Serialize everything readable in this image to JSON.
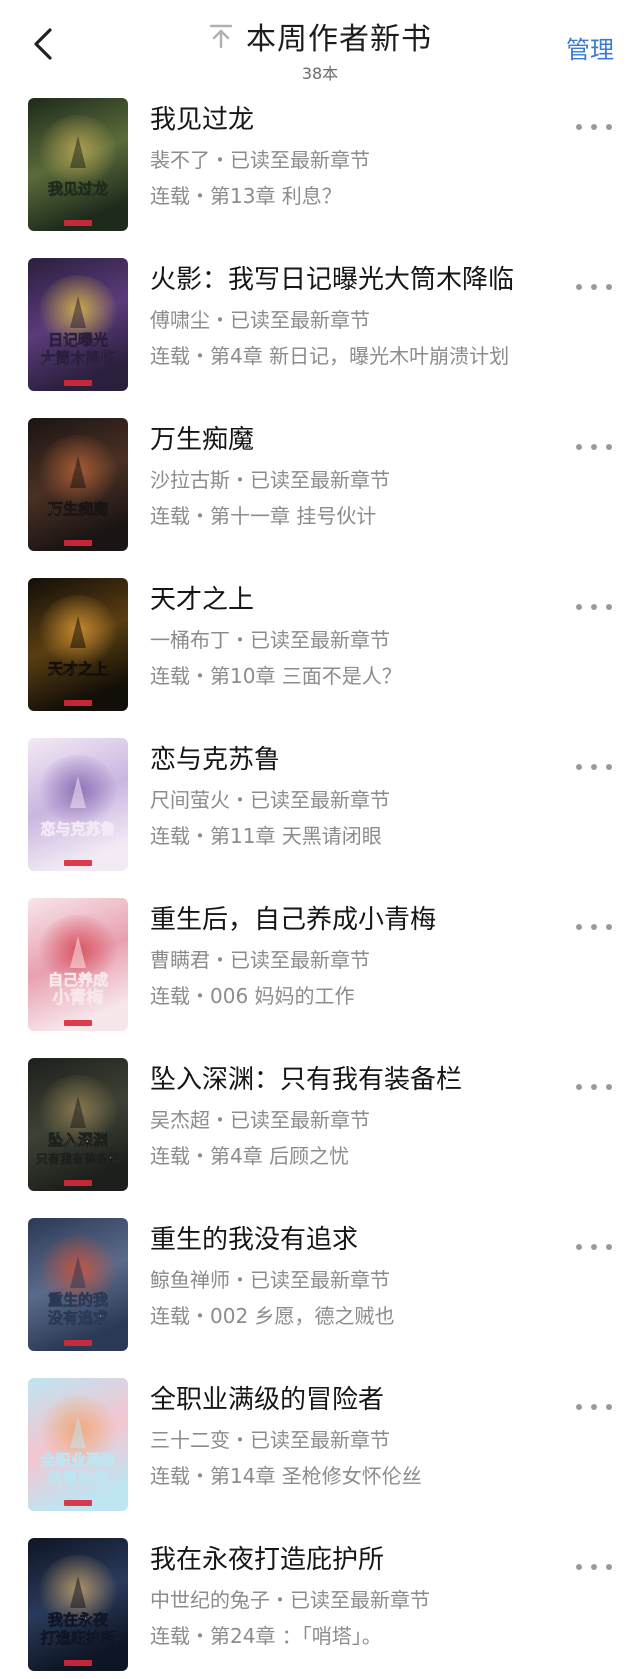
{
  "header": {
    "title": "本周作者新书",
    "count": "38本",
    "manage_label": "管理"
  },
  "books": [
    {
      "title": "我见过龙",
      "author_line": "裴不了・已读至最新章节",
      "chapter_line": "连载・第13章 利息？",
      "cover_text": "我见过龙",
      "cover_colors": [
        "#1d2a1c",
        "#5b6b3a",
        "#c9b15a"
      ]
    },
    {
      "title": "火影：我写日记曝光大筒木降临",
      "author_line": "傅啸尘・已读至最新章节",
      "chapter_line": "连载・第4章 新日记，曝光木叶崩溃计划",
      "cover_text": "日记曝光 大筒木降临",
      "cover_colors": [
        "#2a1f3d",
        "#5b3b7a",
        "#f0d040"
      ]
    },
    {
      "title": "万生痴魔",
      "author_line": "沙拉古斯・已读至最新章节",
      "chapter_line": "连载・第十一章 挂号伙计",
      "cover_text": "万生痴魔",
      "cover_colors": [
        "#1a1414",
        "#4a3024",
        "#c46a3a"
      ]
    },
    {
      "title": "天才之上",
      "author_line": "一桶布丁・已读至最新章节",
      "chapter_line": "连载・第10章 三面不是人？",
      "cover_text": "天才之上",
      "cover_colors": [
        "#120e08",
        "#5a3e12",
        "#e8a43a"
      ]
    },
    {
      "title": "恋与克苏鲁",
      "author_line": "尺间萤火・已读至最新章节",
      "chapter_line": "连载・第11章 天黑请闭眼",
      "cover_text": "恋与克苏鲁",
      "cover_colors": [
        "#f3eaf5",
        "#c9b6e0",
        "#7a5aa8"
      ]
    },
    {
      "title": "重生后，自己养成小青梅",
      "author_line": "曹瞒君・已读至最新章节",
      "chapter_line": "连载・006 妈妈的工作",
      "cover_text": "自己养成 小青梅",
      "cover_colors": [
        "#f7e6ea",
        "#e8a0b0",
        "#d23a4a"
      ]
    },
    {
      "title": "坠入深渊：只有我有装备栏",
      "author_line": "吴杰超・已读至最新章节",
      "chapter_line": "连载・第4章 后顾之忧",
      "cover_text": "坠入深渊 只有我有装备栏",
      "cover_colors": [
        "#1d1f1c",
        "#3e4234",
        "#a08a5a"
      ]
    },
    {
      "title": "重生的我没有追求",
      "author_line": "鲸鱼禅师・已读至最新章节",
      "chapter_line": "连载・002 乡愿，德之贼也",
      "cover_text": "重生的我 没有追求",
      "cover_colors": [
        "#2a3a55",
        "#5a6a8a",
        "#e05030"
      ]
    },
    {
      "title": "全职业满级的冒险者",
      "author_line": "三十二变・已读至最新章节",
      "chapter_line": "连载・第14章 圣枪修女怀伦丝",
      "cover_text": "全职业满级 的冒险者",
      "cover_colors": [
        "#bfe4f2",
        "#f3c6d0",
        "#f0a060"
      ]
    },
    {
      "title": "我在永夜打造庇护所",
      "author_line": "中世纪的兔子・已读至最新章节",
      "chapter_line": "连载・第24章 ：「哨塔」。",
      "cover_text": "我在永夜 打造庇护所",
      "cover_colors": [
        "#0e1524",
        "#2a3a5a",
        "#d8b070"
      ]
    }
  ]
}
